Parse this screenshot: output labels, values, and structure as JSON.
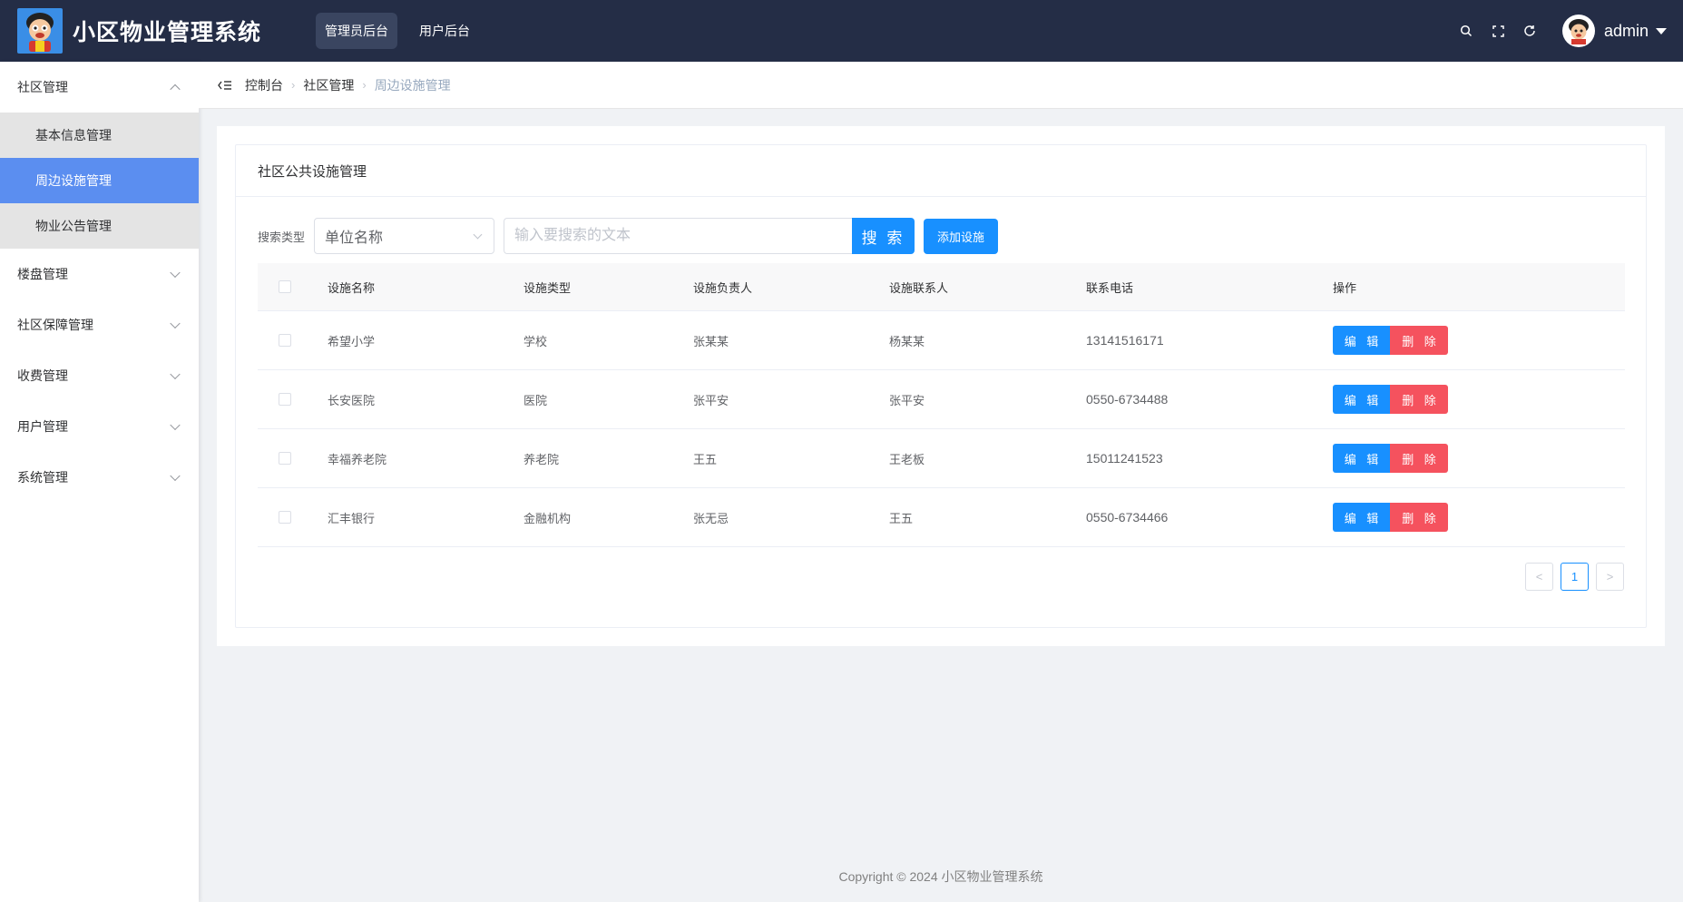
{
  "header": {
    "app_title": "小区物业管理系统",
    "logo_icon": "cartoon-mascot-logo",
    "nav": [
      {
        "label": "管理员后台",
        "active": true
      },
      {
        "label": "用户后台",
        "active": false
      }
    ],
    "username": "admin",
    "icons": [
      "search-icon",
      "fullscreen-icon",
      "refresh-icon"
    ]
  },
  "sidebar": {
    "groups": [
      {
        "label": "社区管理",
        "expanded": true,
        "items": [
          {
            "label": "基本信息管理",
            "active": false
          },
          {
            "label": "周边设施管理",
            "active": true
          },
          {
            "label": "物业公告管理",
            "active": false
          }
        ]
      },
      {
        "label": "楼盘管理",
        "expanded": false
      },
      {
        "label": "社区保障管理",
        "expanded": false
      },
      {
        "label": "收费管理",
        "expanded": false
      },
      {
        "label": "用户管理",
        "expanded": false
      },
      {
        "label": "系统管理",
        "expanded": false
      }
    ]
  },
  "breadcrumb": [
    "控制台",
    "社区管理",
    "周边设施管理"
  ],
  "card": {
    "title": "社区公共设施管理",
    "search_label": "搜索类型",
    "search_type_value": "单位名称",
    "search_placeholder": "输入要搜索的文本",
    "search_button": "搜 索",
    "add_button": "添加设施"
  },
  "table": {
    "columns": [
      "设施名称",
      "设施类型",
      "设施负责人",
      "设施联系人",
      "联系电话",
      "操作"
    ],
    "rows": [
      {
        "name": "希望小学",
        "type": "学校",
        "manager": "张某某",
        "contact": "杨某某",
        "phone": "13141516171"
      },
      {
        "name": "长安医院",
        "type": "医院",
        "manager": "张平安",
        "contact": "张平安",
        "phone": "0550-6734488"
      },
      {
        "name": "幸福养老院",
        "type": "养老院",
        "manager": "王五",
        "contact": "王老板",
        "phone": "15011241523"
      },
      {
        "name": "汇丰银行",
        "type": "金融机构",
        "manager": "张无忌",
        "contact": "王五",
        "phone": "0550-6734466"
      }
    ],
    "edit_label": "编 辑",
    "delete_label": "删 除"
  },
  "pagination": {
    "prev": "<",
    "current": "1",
    "next": ">"
  },
  "footer": "Copyright © 2024 小区物业管理系统",
  "colors": {
    "header_bg": "#242d46",
    "primary": "#1890ff",
    "danger": "#f5525e",
    "menu_active": "#5b8ef0"
  }
}
